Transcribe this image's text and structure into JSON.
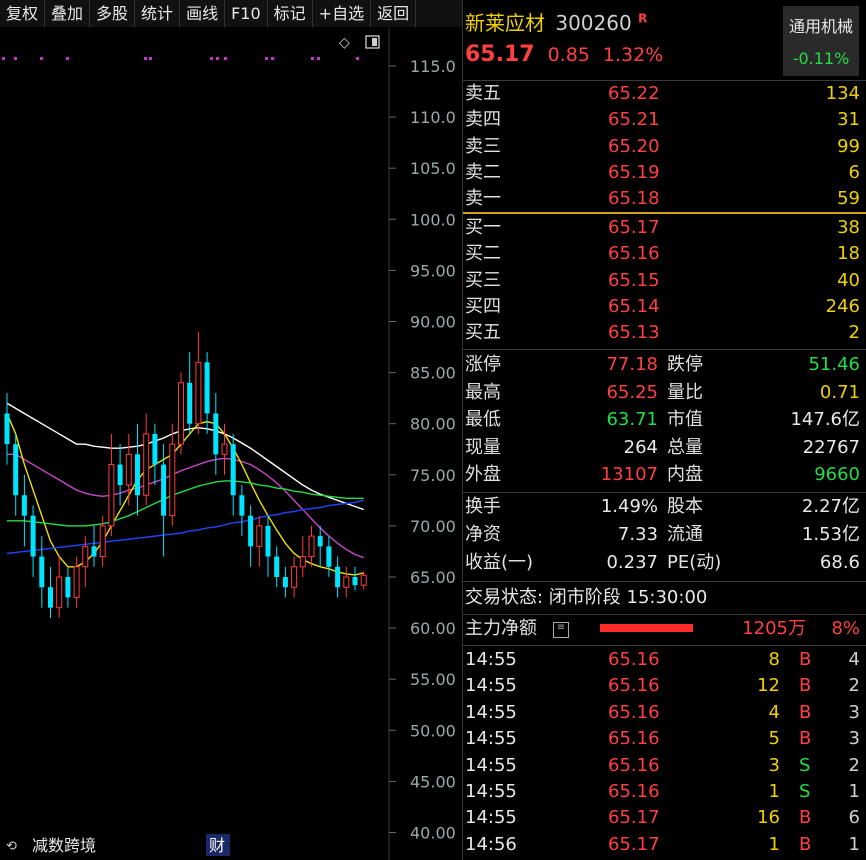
{
  "toolbar": [
    "复权",
    "叠加",
    "多股",
    "统计",
    "画线",
    "F10",
    "标记",
    "+自选",
    "返回"
  ],
  "chart": {
    "y_ticks": [
      "115.0",
      "110.0",
      "105.0",
      "100.0",
      "95.00",
      "90.00",
      "85.00",
      "80.00",
      "75.00",
      "70.00",
      "65.00",
      "60.00",
      "55.00",
      "50.00",
      "45.00",
      "40.00"
    ],
    "bottom_labels": {
      "left": "减数跨境",
      "finance_marker": "财"
    },
    "candles": [
      {
        "o": 81,
        "c": 78,
        "h": 83,
        "l": 76
      },
      {
        "o": 78,
        "c": 73,
        "h": 79,
        "l": 71
      },
      {
        "o": 73,
        "c": 71,
        "h": 75,
        "l": 68
      },
      {
        "o": 71,
        "c": 67,
        "h": 72,
        "l": 65
      },
      {
        "o": 67,
        "c": 64,
        "h": 69,
        "l": 62
      },
      {
        "o": 64,
        "c": 62,
        "h": 66,
        "l": 61
      },
      {
        "o": 62,
        "c": 65,
        "h": 67,
        "l": 61
      },
      {
        "o": 65,
        "c": 63,
        "h": 66,
        "l": 62
      },
      {
        "o": 63,
        "c": 66,
        "h": 67,
        "l": 62
      },
      {
        "o": 66,
        "c": 68,
        "h": 69,
        "l": 64
      },
      {
        "o": 68,
        "c": 67,
        "h": 70,
        "l": 66
      },
      {
        "o": 67,
        "c": 70,
        "h": 71,
        "l": 66
      },
      {
        "o": 70,
        "c": 76,
        "h": 79,
        "l": 69
      },
      {
        "o": 76,
        "c": 74,
        "h": 78,
        "l": 72
      },
      {
        "o": 74,
        "c": 77,
        "h": 79,
        "l": 72
      },
      {
        "o": 77,
        "c": 73,
        "h": 80,
        "l": 71
      },
      {
        "o": 73,
        "c": 79,
        "h": 81,
        "l": 72
      },
      {
        "o": 79,
        "c": 76,
        "h": 80,
        "l": 74
      },
      {
        "o": 76,
        "c": 71,
        "h": 78,
        "l": 67
      },
      {
        "o": 71,
        "c": 78,
        "h": 80,
        "l": 70
      },
      {
        "o": 78,
        "c": 84,
        "h": 85,
        "l": 77
      },
      {
        "o": 84,
        "c": 80,
        "h": 87,
        "l": 79
      },
      {
        "o": 80,
        "c": 86,
        "h": 89,
        "l": 79
      },
      {
        "o": 86,
        "c": 81,
        "h": 87,
        "l": 79
      },
      {
        "o": 81,
        "c": 77,
        "h": 83,
        "l": 75
      },
      {
        "o": 77,
        "c": 78,
        "h": 80,
        "l": 75
      },
      {
        "o": 78,
        "c": 73,
        "h": 79,
        "l": 71
      },
      {
        "o": 73,
        "c": 71,
        "h": 74,
        "l": 69
      },
      {
        "o": 71,
        "c": 68,
        "h": 72,
        "l": 66
      },
      {
        "o": 68,
        "c": 70,
        "h": 71,
        "l": 66
      },
      {
        "o": 70,
        "c": 67,
        "h": 71,
        "l": 65
      },
      {
        "o": 67,
        "c": 65,
        "h": 68,
        "l": 64
      },
      {
        "o": 65,
        "c": 64,
        "h": 66,
        "l": 63
      },
      {
        "o": 64,
        "c": 66,
        "h": 67,
        "l": 63
      },
      {
        "o": 66,
        "c": 67,
        "h": 69,
        "l": 65
      },
      {
        "o": 67,
        "c": 69,
        "h": 70,
        "l": 66
      },
      {
        "o": 69,
        "c": 68,
        "h": 70,
        "l": 66
      },
      {
        "o": 68,
        "c": 66,
        "h": 69,
        "l": 65
      },
      {
        "o": 66,
        "c": 64,
        "h": 67,
        "l": 63
      },
      {
        "o": 64,
        "c": 65,
        "h": 66,
        "l": 63
      },
      {
        "o": 65,
        "c": 64.2,
        "h": 66,
        "l": 63.7
      },
      {
        "o": 64.2,
        "c": 65.17,
        "h": 65.5,
        "l": 63.8
      }
    ],
    "ma": [
      {
        "color": "#ffffff",
        "values": [
          82,
          81.5,
          81,
          80.5,
          80,
          79.5,
          79,
          78.5,
          78,
          78,
          77.8,
          77.7,
          77.6,
          77.6,
          77.7,
          77.8,
          78,
          78.3,
          78.6,
          79,
          79.3,
          79.5,
          79.6,
          79.5,
          79.3,
          79,
          78.6,
          78.1,
          77.6,
          77,
          76.4,
          75.8,
          75.2,
          74.6,
          74,
          73.5,
          73.1,
          72.8,
          72.5,
          72.2,
          71.9,
          71.6
        ]
      },
      {
        "color": "#cc44cc",
        "values": [
          77,
          77,
          76.5,
          76,
          75.5,
          75,
          74.5,
          74,
          73.5,
          73.2,
          73,
          72.9,
          73,
          73.2,
          73.5,
          73.7,
          74,
          74.3,
          74.6,
          75,
          75.4,
          75.7,
          76,
          76.3,
          76.5,
          76.6,
          76.5,
          76.3,
          76,
          75.5,
          74.9,
          74.2,
          73.4,
          72.5,
          71.6,
          70.7,
          69.8,
          69,
          68.3,
          67.7,
          67.2,
          66.9
        ]
      },
      {
        "color": "#f0e000",
        "values": [
          81,
          79,
          76,
          73.5,
          71,
          68.5,
          67,
          66,
          66,
          66.5,
          67.3,
          68.5,
          70,
          71.5,
          73,
          74.5,
          75.5,
          76,
          76.5,
          77,
          78,
          79,
          80,
          80.2,
          80,
          79,
          77.6,
          76,
          74.2,
          72.5,
          71,
          69.6,
          68.3,
          67.3,
          66.7,
          66.3,
          66,
          65.8,
          65.5,
          65.3,
          65.2,
          65.4
        ]
      },
      {
        "color": "#22dd44",
        "values": [
          70.5,
          70.5,
          70.5,
          70.4,
          70.3,
          70.2,
          70.1,
          70,
          70,
          70,
          70.1,
          70.2,
          70.4,
          70.7,
          71,
          71.4,
          71.8,
          72.2,
          72.6,
          73,
          73.3,
          73.6,
          73.9,
          74.1,
          74.3,
          74.4,
          74.4,
          74.3,
          74.2,
          74,
          73.9,
          73.7,
          73.6,
          73.4,
          73.3,
          73.1,
          73,
          72.9,
          72.8,
          72.7,
          72.7,
          72.7
        ]
      },
      {
        "color": "#2244ff",
        "values": [
          67.3,
          67.4,
          67.5,
          67.6,
          67.7,
          67.8,
          67.9,
          68,
          68.1,
          68.2,
          68.3,
          68.4,
          68.5,
          68.6,
          68.7,
          68.8,
          68.9,
          69,
          69.1,
          69.2,
          69.3,
          69.5,
          69.6,
          69.8,
          69.9,
          70.1,
          70.3,
          70.4,
          70.6,
          70.8,
          71,
          71.1,
          71.3,
          71.4,
          71.6,
          71.7,
          71.8,
          72,
          72.1,
          72.2,
          72.3,
          72.5
        ]
      }
    ]
  },
  "stock": {
    "name": "新莱应材",
    "code": "300260",
    "badge": "R",
    "price": "65.17",
    "change": "0.85",
    "change_pct": "1.32%",
    "sector": "通用机械",
    "sector_pct": "-0.11%"
  },
  "asks": [
    {
      "label": "卖五",
      "price": "65.22",
      "vol": "134"
    },
    {
      "label": "卖四",
      "price": "65.21",
      "vol": "31"
    },
    {
      "label": "卖三",
      "price": "65.20",
      "vol": "99"
    },
    {
      "label": "卖二",
      "price": "65.19",
      "vol": "6"
    },
    {
      "label": "卖一",
      "price": "65.18",
      "vol": "59"
    }
  ],
  "bids": [
    {
      "label": "买一",
      "price": "65.17",
      "vol": "38"
    },
    {
      "label": "买二",
      "price": "65.16",
      "vol": "18"
    },
    {
      "label": "买三",
      "price": "65.15",
      "vol": "40"
    },
    {
      "label": "买四",
      "price": "65.14",
      "vol": "246"
    },
    {
      "label": "买五",
      "price": "65.13",
      "vol": "2"
    }
  ],
  "stats1": [
    {
      "l1": "涨停",
      "v1": "77.18",
      "c1": "red",
      "l2": "跌停",
      "v2": "51.46",
      "c2": "green"
    },
    {
      "l1": "最高",
      "v1": "65.25",
      "c1": "red",
      "l2": "量比",
      "v2": "0.71",
      "c2": "yellow"
    },
    {
      "l1": "最低",
      "v1": "63.71",
      "c1": "green",
      "l2": "市值",
      "v2": "147.6亿",
      "c2": "white"
    },
    {
      "l1": "现量",
      "v1": "264",
      "c1": "white",
      "l2": "总量",
      "v2": "22767",
      "c2": "white"
    },
    {
      "l1": "外盘",
      "v1": "13107",
      "c1": "red",
      "l2": "内盘",
      "v2": "9660",
      "c2": "green"
    }
  ],
  "stats2": [
    {
      "l1": "换手",
      "v1": "1.49%",
      "l2": "股本",
      "v2": "2.27亿"
    },
    {
      "l1": "净资",
      "v1": "7.33",
      "l2": "流通",
      "v2": "1.53亿"
    },
    {
      "l1": "收益(一)",
      "v1": "0.237",
      "l2": "PE(动)",
      "v2": "68.6"
    }
  ],
  "trade_status": "交易状态: 闭市阶段 15:30:00",
  "main_flow": {
    "label": "主力净额",
    "value": "1205万",
    "pct": "8%",
    "bar_fraction": 0.75
  },
  "ticks": [
    {
      "time": "14:55",
      "price": "65.16",
      "vol": "8",
      "side": "B",
      "n": "4"
    },
    {
      "time": "14:55",
      "price": "65.16",
      "vol": "12",
      "side": "B",
      "n": "2"
    },
    {
      "time": "14:55",
      "price": "65.16",
      "vol": "4",
      "side": "B",
      "n": "3"
    },
    {
      "time": "14:55",
      "price": "65.16",
      "vol": "5",
      "side": "B",
      "n": "3"
    },
    {
      "time": "14:55",
      "price": "65.16",
      "vol": "3",
      "side": "S",
      "n": "2"
    },
    {
      "time": "14:55",
      "price": "65.16",
      "vol": "1",
      "side": "S",
      "n": "1"
    },
    {
      "time": "14:55",
      "price": "65.17",
      "vol": "16",
      "side": "B",
      "n": "6"
    },
    {
      "time": "14:56",
      "price": "65.17",
      "vol": "1",
      "side": "B",
      "n": "1"
    }
  ],
  "colors": {
    "up": "#ff3b3b",
    "down": "#00e5ff",
    "accent": "#ff3b3b"
  }
}
